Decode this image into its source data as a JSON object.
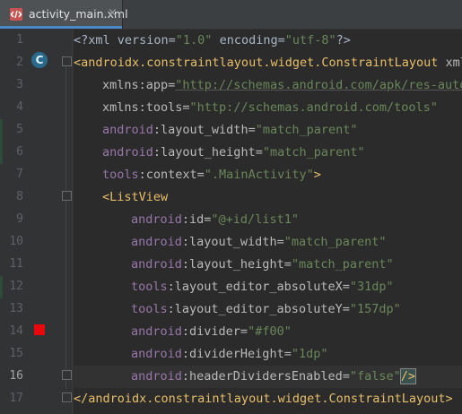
{
  "tab": {
    "label": "activity_main.xml",
    "close": "×",
    "icon": "xml-file-icon"
  },
  "gutter": {
    "line_numbers": [
      "1",
      "2",
      "3",
      "4",
      "5",
      "6",
      "7",
      "8",
      "9",
      "10",
      "11",
      "12",
      "13",
      "14",
      "15",
      "16",
      "17"
    ],
    "current_line": 16,
    "class_marker": "C",
    "breakpoint_line": 14
  },
  "colors": {
    "background": "#2b2b2b",
    "gutter": "#313335",
    "tag": "#e8bf6a",
    "attribute": "#bababa",
    "namespace": "#9876aa",
    "value": "#6a8759",
    "text": "#a9b7c6",
    "breakpoint": "#e8070b"
  },
  "code": {
    "l1_a": "<?xml version=",
    "l1_b": "\"1.0\"",
    "l1_c": " encoding=",
    "l1_d": "\"utf-8\"",
    "l1_e": "?>",
    "l2_a": "<androidx.constraintlayout.widget.ConstraintLayout",
    "l2_b": " xml",
    "l3_a": "xmlns:app=",
    "l3_b": "\"http://schemas.android.com/apk/res-auto\"",
    "l4_a": "xmlns:tools=",
    "l4_b": "\"http://schemas.android.com/tools\"",
    "l5_a": "android",
    "l5_b": ":layout_width=",
    "l5_c": "\"match_parent\"",
    "l6_a": "android",
    "l6_b": ":layout_height=",
    "l6_c": "\"match_parent\"",
    "l7_a": "tools",
    "l7_b": ":context=",
    "l7_c": "\".MainActivity\"",
    "l7_d": ">",
    "l8_a": "<ListView",
    "l9_a": "android",
    "l9_b": ":id=",
    "l9_c": "\"@+id/list1\"",
    "l10_a": "android",
    "l10_b": ":layout_width=",
    "l10_c": "\"match_parent\"",
    "l11_a": "android",
    "l11_b": ":layout_height=",
    "l11_c": "\"match_parent\"",
    "l12_a": "tools",
    "l12_b": ":layout_editor_absoluteX=",
    "l12_c": "\"31dp\"",
    "l13_a": "tools",
    "l13_b": ":layout_editor_absoluteY=",
    "l13_c": "\"157dp\"",
    "l14_a": "android",
    "l14_b": ":divider=",
    "l14_c": "\"#f00\"",
    "l15_a": "android",
    "l15_b": ":dividerHeight=",
    "l15_c": "\"1dp\"",
    "l16_a": "android",
    "l16_b": ":headerDividersEnabled=",
    "l16_c": "\"false\"",
    "l16_d": "/>",
    "l17_a": "</androidx.constraintlayout.widget.ConstraintLayout>"
  }
}
